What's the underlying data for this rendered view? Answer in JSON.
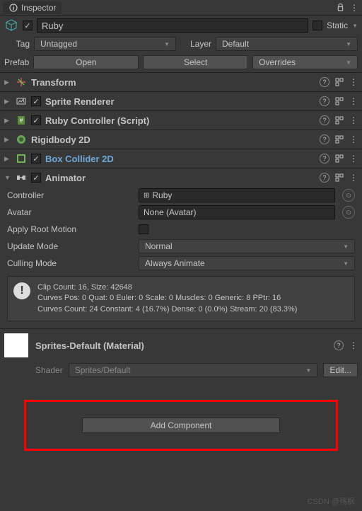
{
  "header": {
    "title": "Inspector"
  },
  "object": {
    "enabled": true,
    "name": "Ruby",
    "static_label": "Static",
    "tag_label": "Tag",
    "tag_value": "Untagged",
    "layer_label": "Layer",
    "layer_value": "Default",
    "prefab_label": "Prefab",
    "prefab_open": "Open",
    "prefab_select": "Select",
    "prefab_overrides": "Overrides"
  },
  "components": [
    {
      "name": "Transform",
      "enabled": null,
      "expanded": false
    },
    {
      "name": "Sprite Renderer",
      "enabled": true,
      "expanded": false
    },
    {
      "name": "Ruby Controller (Script)",
      "enabled": true,
      "expanded": false
    },
    {
      "name": "Rigidbody 2D",
      "enabled": null,
      "expanded": false
    },
    {
      "name": "Box Collider 2D",
      "enabled": true,
      "expanded": false,
      "highlight": true
    },
    {
      "name": "Animator",
      "enabled": true,
      "expanded": true
    }
  ],
  "animator": {
    "controller_label": "Controller",
    "controller_value": "Ruby",
    "avatar_label": "Avatar",
    "avatar_value": "None (Avatar)",
    "apply_root_label": "Apply Root Motion",
    "apply_root_value": false,
    "update_mode_label": "Update Mode",
    "update_mode_value": "Normal",
    "culling_mode_label": "Culling Mode",
    "culling_mode_value": "Always Animate",
    "info": "Clip Count: 16, Size: 42648\nCurves Pos: 0 Quat: 0 Euler: 0 Scale: 0 Muscles: 0 Generic: 8 PPtr: 16\nCurves Count: 24 Constant: 4 (16.7%) Dense: 0 (0.0%) Stream: 20 (83.3%)"
  },
  "material": {
    "title": "Sprites-Default (Material)",
    "shader_label": "Shader",
    "shader_value": "Sprites/Default",
    "edit_label": "Edit..."
  },
  "add_component": "Add Component",
  "watermark": "CSDN @殇枫"
}
